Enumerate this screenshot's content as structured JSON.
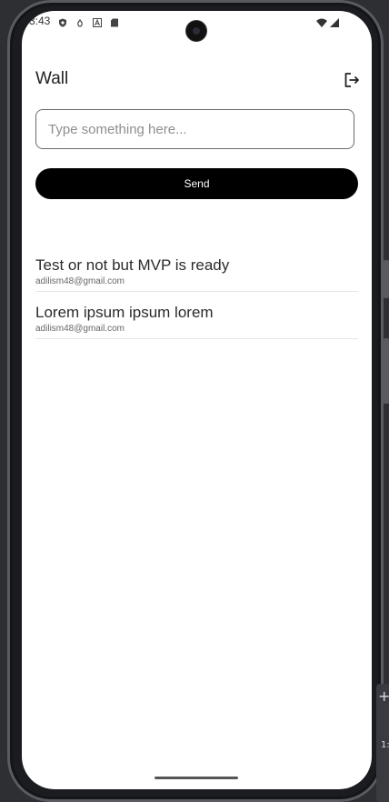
{
  "status_bar": {
    "time": "3:43",
    "left_icons": [
      "shield-icon",
      "bug-icon",
      "font-icon",
      "sd-card-icon"
    ],
    "right_icons": [
      "wifi-icon",
      "signal-icon"
    ]
  },
  "header": {
    "title": "Wall",
    "logout_icon": "logout-icon"
  },
  "composer": {
    "placeholder": "Type something here...",
    "value": "",
    "send_label": "Send"
  },
  "posts": [
    {
      "text": "Test or not but MVP is ready",
      "author": "adilism48@gmail.com"
    },
    {
      "text": "Lorem ipsum ipsum lorem",
      "author": "adilism48@gmail.com"
    }
  ],
  "ide_overlay": {
    "plus": "+",
    "text": "1:"
  },
  "colors": {
    "send_button_bg": "#000000",
    "screen_bg": "#ffffff",
    "frame": "#1b1c1f"
  }
}
